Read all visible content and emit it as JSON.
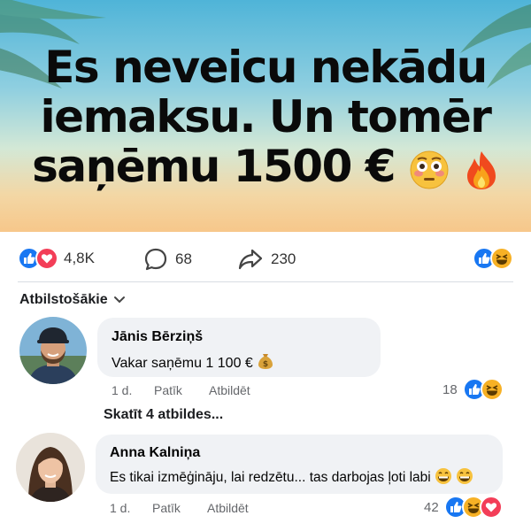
{
  "post": {
    "headline": {
      "line1": "Es neveicu nekādu",
      "line2": "iemaksu. Un tomēr",
      "line3": "saņēmu 1500 €"
    },
    "headline_emojis": [
      "flushed-face",
      "fire"
    ]
  },
  "stats": {
    "reaction_count": "4,8K",
    "comment_count": "68",
    "share_count": "230"
  },
  "comments_section": {
    "sort_label": "Atbilstošākie"
  },
  "comments": [
    {
      "author": "Jānis Bērziņš",
      "text": "Vakar saņēmu 1 100 €",
      "text_emoji": "money-bag",
      "time": "1 d.",
      "like_label": "Patīk",
      "reply_label": "Atbildēt",
      "reactions": "18",
      "view_replies": "Skatīt 4 atbildes..."
    },
    {
      "author": "Anna Kalniņa",
      "text": "Es tikai izmēģināju, lai redzētu... tas darbojas ļoti labi",
      "text_emoji": "grinning-face-x2",
      "time": "1 d.",
      "like_label": "Patīk",
      "reply_label": "Atbildēt",
      "reactions": "42"
    }
  ],
  "colors": {
    "like_blue": "#1877f2",
    "love_red": "#f33e58",
    "haha_yellow": "#f7b125",
    "bubble_bg": "#f0f2f5",
    "meta_gray": "#65676b"
  }
}
